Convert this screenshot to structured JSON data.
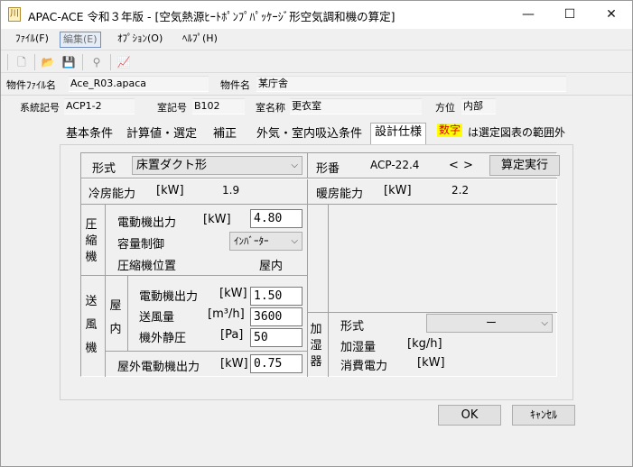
{
  "window": {
    "title": "APAC-ACE 令和３年版 - [空気熱源ﾋｰﾄﾎﾟﾝﾌﾟﾊﾟｯｹｰｼﾞ形空気調和機の算定]",
    "icon_glyph": "川",
    "minimize": "—",
    "maximize": "☐",
    "close": "✕"
  },
  "menu": [
    "ﾌｧｲﾙ(F)",
    "編集(E)",
    "ｵﾌﾟｼｮﾝ(O)",
    "ﾍﾙﾌﾟ(H)"
  ],
  "toolbar": {
    "icons": [
      "new-file-icon",
      "open-folder-icon",
      "save-icon",
      "binoculars-icon",
      "chart-icon"
    ],
    "glyphs": [
      "🗋",
      "📂",
      "💾",
      "⚲",
      "📈"
    ]
  },
  "info": {
    "file_label": "物件ﾌｧｲﾙ名",
    "file_value": "Ace_R03.apaca",
    "property_label": "物件名",
    "property_value": "某庁舎",
    "system_label": "系統記号",
    "system_value": "ACP1-2",
    "room_no_label": "室記号",
    "room_no_value": "B102",
    "room_name_label": "室名称",
    "room_name_value": "更衣室",
    "direction_label": "方位",
    "direction_value": "内部"
  },
  "tabs": [
    "基本条件",
    "計算値・選定",
    "補正",
    "外気・室内吸込条件",
    "設計仕様"
  ],
  "note": {
    "badge": "数字",
    "text": "は選定図表の範囲外",
    "badge_color": "#ffff00",
    "badge_text_color": "#d40000"
  },
  "form": {
    "type_label": "形式",
    "type_value": "床置ダクト形",
    "model_label": "形番",
    "model_value": "ACP-22.4",
    "model_prev": "<",
    "model_next": ">",
    "calc_button": "算定実行",
    "cooling_label": "冷房能力",
    "cooling_unit": "[kW]",
    "cooling_value": "1.9",
    "heating_label": "暖房能力",
    "heating_unit": "[kW]",
    "heating_value": "2.2",
    "compressor_label": "圧縮機",
    "comp_motor_label": "電動機出力",
    "comp_motor_unit": "[kW]",
    "comp_motor_value": "4.80",
    "capacity_ctrl_label": "容量制御",
    "capacity_ctrl_value": "ｲﾝﾊﾞｰﾀｰ",
    "comp_position_label": "圧縮機位置",
    "comp_position_value": "屋内",
    "fan_label": "送風機",
    "indoor_label": "屋内",
    "fan_motor_label": "電動機出力",
    "fan_motor_unit": "[kW]",
    "fan_motor_value": "1.50",
    "airflow_label": "送風量",
    "airflow_unit": "[m³/h]",
    "airflow_value": "3600",
    "static_label": "機外静圧",
    "static_unit": "[Pa]",
    "static_value": "50",
    "outdoor_motor_label": "屋外電動機出力",
    "outdoor_motor_unit": "[kW]",
    "outdoor_motor_value": "0.75",
    "humidifier_label": "加湿器",
    "hum_type_label": "形式",
    "hum_type_value": "ー",
    "hum_amount_label": "加湿量",
    "hum_amount_unit": "[kg/h]",
    "hum_power_label": "消費電力",
    "hum_power_unit": "[kW]"
  },
  "buttons": {
    "ok": "OK",
    "cancel": "ｷｬﾝｾﾙ"
  }
}
